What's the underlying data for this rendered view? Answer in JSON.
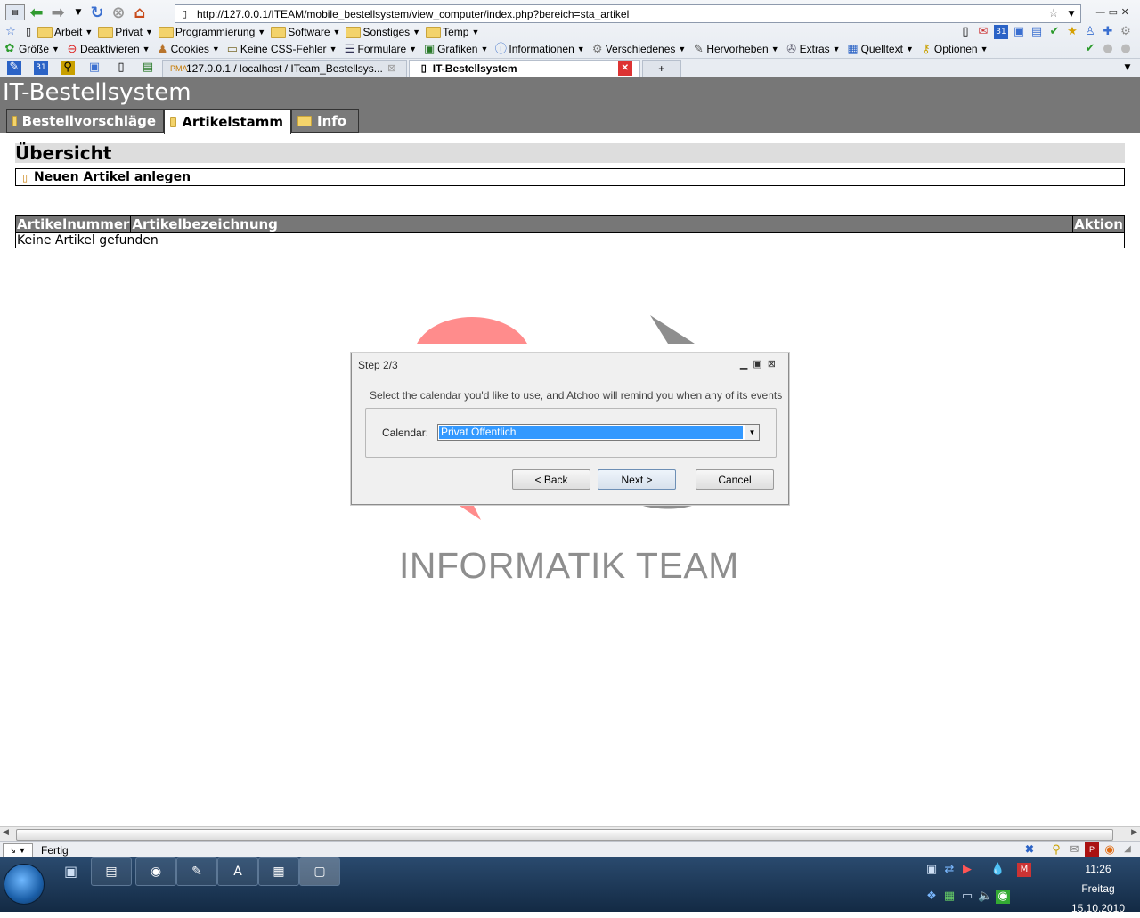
{
  "browser": {
    "url": "http://127.0.0.1/ITEAM/mobile_bestellsystem/view_computer/index.php?bereich=sta_artikel",
    "bookmarks": [
      "Arbeit",
      "Privat",
      "Programmierung",
      "Software",
      "Sonstiges",
      "Temp"
    ],
    "devtools": [
      "Größe",
      "Deaktivieren",
      "Cookies",
      "Keine CSS-Fehler",
      "Formulare",
      "Grafiken",
      "Informationen",
      "Verschiedenes",
      "Hervorheben",
      "Extras",
      "Quelltext",
      "Optionen"
    ],
    "tabs": [
      {
        "label": "127.0.0.1 / localhost / ITeam_Bestellsys..."
      },
      {
        "label": "IT-Bestellsystem"
      }
    ],
    "status_text": "Fertig"
  },
  "page": {
    "site_title": "IT-Bestellsystem",
    "tabs": [
      "Bestellvorschläge",
      "Artikelstamm",
      "Info"
    ],
    "section_title": "Übersicht",
    "new_item_label": "Neuen Artikel anlegen",
    "table": {
      "headers": [
        "Artikelnummer",
        "Artikelbezeichnung",
        "Aktion"
      ],
      "empty_message": "Keine Artikel gefunden"
    },
    "logo_text": "INFORMATIK TEAM"
  },
  "dialog": {
    "title": "Step 2/3",
    "description": "Select the calendar you'd like to use, and Atchoo will remind you when any of its events o",
    "calendar_label": "Calendar:",
    "calendar_value": "Privat Öffentlich",
    "buttons": {
      "back": "< Back",
      "next": "Next >",
      "cancel": "Cancel"
    }
  },
  "taskbar": {
    "time": "11:26",
    "day": "Freitag",
    "date": "15.10.2010"
  }
}
